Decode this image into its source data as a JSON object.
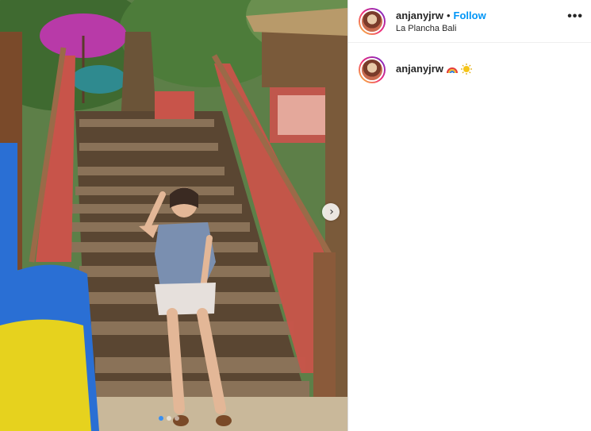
{
  "post": {
    "username": "anjanyjrw",
    "separator": "•",
    "follow_label": "Follow",
    "location": "La Plancha Bali",
    "more_icon": "more-options-icon",
    "caption_username": "anjanyjrw",
    "caption_emojis": [
      "rainbow-emoji",
      "sun-emoji"
    ]
  },
  "carousel": {
    "next_icon": "chevron-right-icon",
    "next_glyph": "›",
    "slide_count": 3,
    "active_slide": 1
  }
}
